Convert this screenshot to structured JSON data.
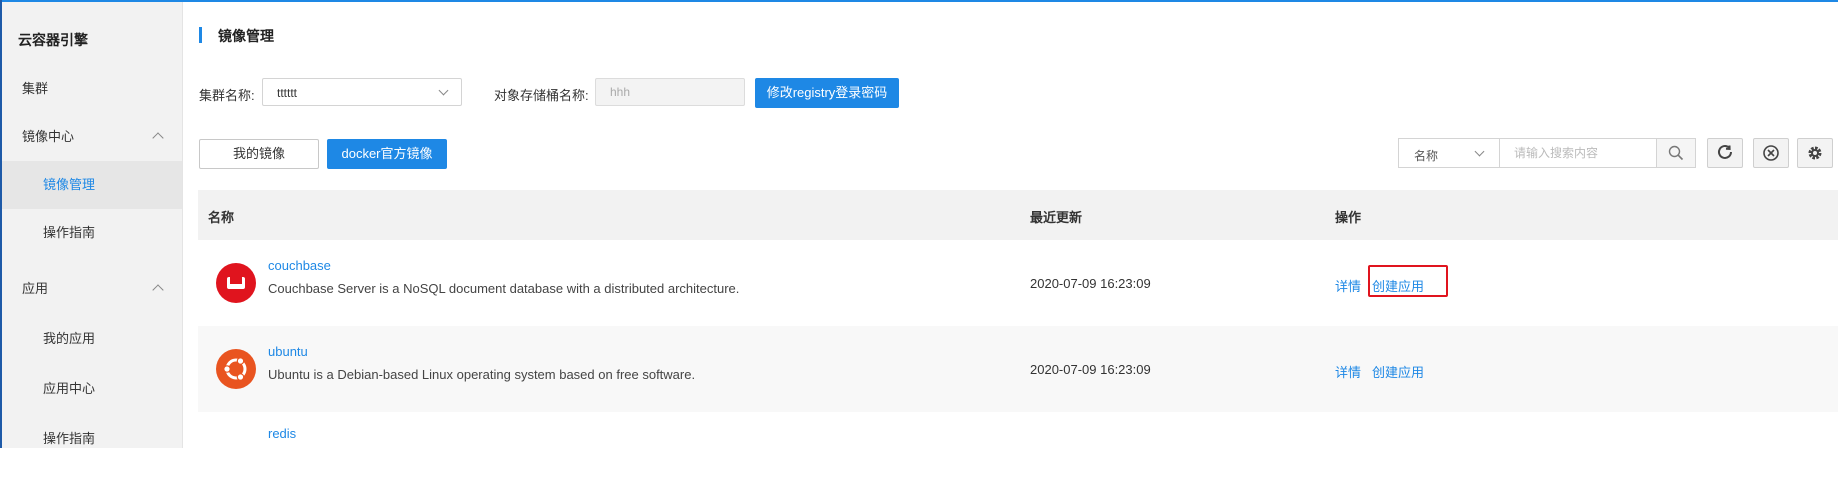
{
  "sidebar": {
    "title": "云容器引擎",
    "items": [
      {
        "label": "集群"
      },
      {
        "label": "镜像中心"
      },
      {
        "label": "镜像管理"
      },
      {
        "label": "操作指南"
      },
      {
        "label": "应用"
      },
      {
        "label": "我的应用"
      },
      {
        "label": "应用中心"
      },
      {
        "label": "操作指南"
      }
    ]
  },
  "header": {
    "title": "镜像管理"
  },
  "filters": {
    "cluster_label": "集群名称:",
    "cluster_value": "tttttt",
    "bucket_label": "对象存储桶名称:",
    "bucket_value": "hhh",
    "modify_button": "修改registry登录密码"
  },
  "tabs": {
    "my_images": "我的镜像",
    "docker_official": "docker官方镜像"
  },
  "search": {
    "field_select": "名称",
    "placeholder": "请输入搜索内容"
  },
  "table": {
    "columns": [
      "名称",
      "最近更新",
      "操作"
    ],
    "rows": [
      {
        "name": "couchbase",
        "description": "Couchbase Server is a NoSQL document database with a distributed architecture.",
        "updated": "2020-07-09 16:23:09",
        "detail": "详情",
        "create": "创建应用",
        "icon": "couchbase-icon"
      },
      {
        "name": "ubuntu",
        "description": "Ubuntu is a Debian-based Linux operating system based on free software.",
        "updated": "2020-07-09 16:23:09",
        "detail": "详情",
        "create": "创建应用",
        "icon": "ubuntu-icon"
      },
      {
        "name": "redis",
        "description": "",
        "updated": "",
        "detail": "",
        "create": "",
        "icon": "redis-icon"
      }
    ]
  },
  "colors": {
    "accent": "#1e88e5",
    "highlight_border": "#e0141e",
    "couchbase": "#e0141e",
    "ubuntu": "#e95420"
  }
}
